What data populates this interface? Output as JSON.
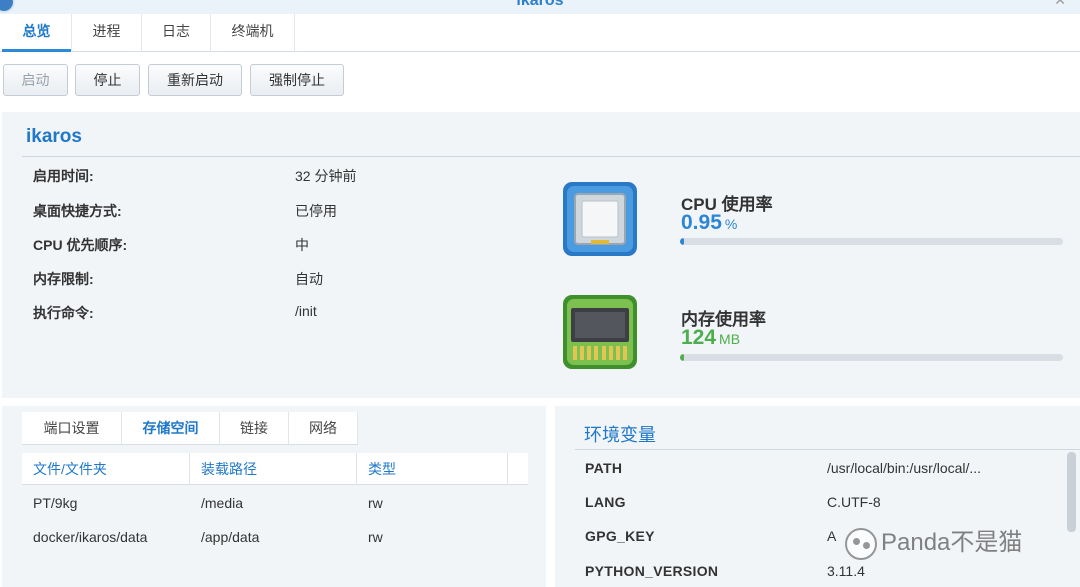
{
  "window": {
    "title": "ikaros"
  },
  "tabs": [
    {
      "label": "总览"
    },
    {
      "label": "进程"
    },
    {
      "label": "日志"
    },
    {
      "label": "终端机"
    }
  ],
  "toolbar": {
    "start_label": "启动",
    "stop_label": "停止",
    "restart_label": "重新启动",
    "force_stop_label": "强制停止"
  },
  "overview": {
    "title": "ikaros",
    "rows": [
      {
        "label": "启用时间:",
        "value": "32 分钟前"
      },
      {
        "label": "桌面快捷方式:",
        "value": "已停用"
      },
      {
        "label": "CPU 优先顺序:",
        "value": "中"
      },
      {
        "label": "内存限制:",
        "value": "自动"
      },
      {
        "label": "执行命令:",
        "value": "/init"
      }
    ],
    "cpu": {
      "title": "CPU 使用率",
      "value": "0.95",
      "unit": "%",
      "percent": 0.95,
      "color": "#2b86d4"
    },
    "memory": {
      "title": "内存使用率",
      "value": "124",
      "unit": "MB",
      "percent": 0.5,
      "color": "#4cae4c"
    }
  },
  "storage": {
    "tabs": [
      {
        "label": "端口设置"
      },
      {
        "label": "存储空间"
      },
      {
        "label": "链接"
      },
      {
        "label": "网络"
      }
    ],
    "columns": [
      "文件/文件夹",
      "装载路径",
      "类型"
    ],
    "rows": [
      [
        "PT/9kg",
        "/media",
        "rw"
      ],
      [
        "docker/ikaros/data",
        "/app/data",
        "rw"
      ]
    ]
  },
  "env": {
    "title": "环境变量",
    "rows": [
      {
        "key": "PATH",
        "value": "/usr/local/bin:/usr/local/..."
      },
      {
        "key": "LANG",
        "value": "C.UTF-8"
      },
      {
        "key": "GPG_KEY",
        "value": "A"
      },
      {
        "key": "PYTHON_VERSION",
        "value": "3.11.4"
      }
    ]
  },
  "watermark": {
    "text": "Panda不是猫"
  }
}
